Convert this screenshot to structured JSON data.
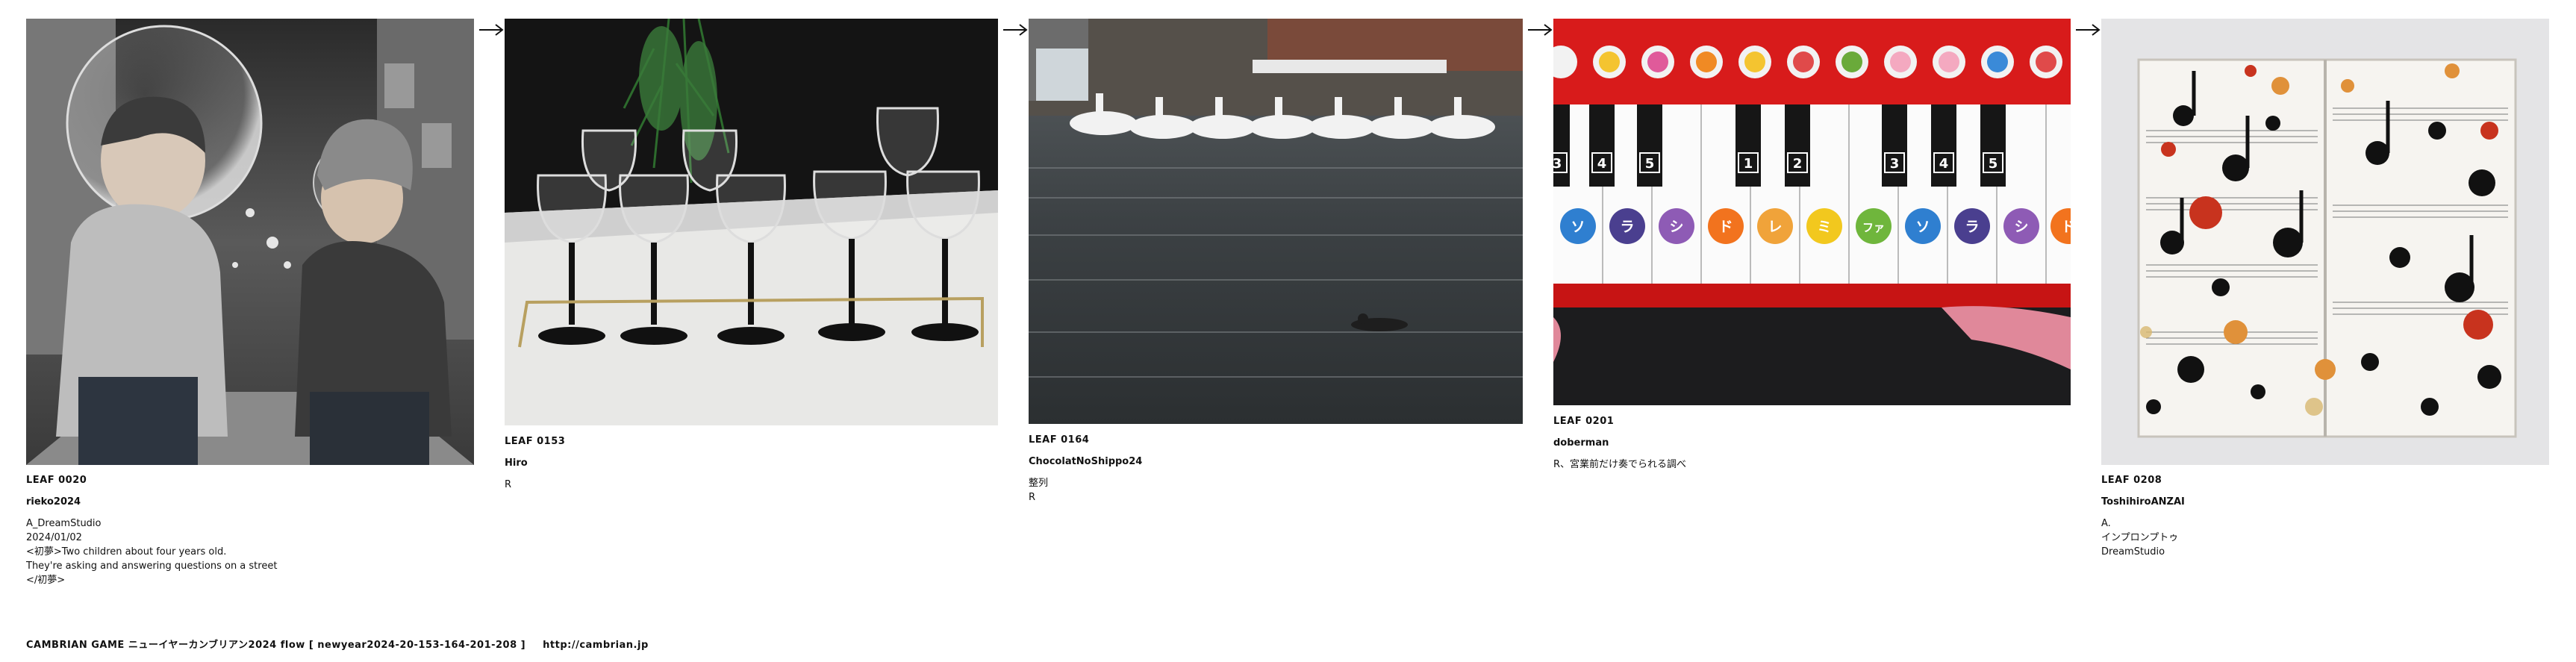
{
  "leaves": [
    {
      "id": "LEAF 0020",
      "author": "rieko2024",
      "desc_lines": [
        "A_DreamStudio",
        "2024/01/02",
        "<初夢>Two children about four years old.",
        "They're asking and answering questions on a street",
        "</初夢>"
      ],
      "image": "Two children in knit caps facing each other on a city street, one touching a large bubble"
    },
    {
      "id": "LEAF 0153",
      "author": "Hiro",
      "desc_lines": [
        "R"
      ],
      "image": "Row of wine glasses on black stems on a white tray with pine branches"
    },
    {
      "id": "LEAF 0164",
      "author": "ChocolatNoShippo24",
      "desc_lines": [
        "整列",
        "R"
      ],
      "image": "Swan paddle boats lined up on a pond with a small bird swimming"
    },
    {
      "id": "LEAF 0201",
      "author": "doberman",
      "desc_lines": [
        "R、宮業前だけ奏でられる調べ"
      ],
      "image": "Red toy keyboard with numbered black keys and katakana note stickers"
    },
    {
      "id": "LEAF 0208",
      "author": "ToshihiroANZAI",
      "desc_lines": [
        "A.",
        "インプロンプトゥ",
        "DreamStudio"
      ],
      "image": "Open sheet music book splattered with black, red and orange paint"
    }
  ],
  "piano_labels": {
    "numbers": [
      "3",
      "4",
      "5",
      "1",
      "2",
      "3",
      "4",
      "5"
    ],
    "solfege": [
      "ソ",
      "ラ",
      "シ",
      "ド",
      "レ",
      "ミ",
      "ファ",
      "ソ",
      "ラ",
      "シ",
      "ド"
    ]
  },
  "arrow_glyph": "→",
  "footer": {
    "text": "CAMBRIAN GAME  ニューイヤーカンブリアン2024  flow [ newyear2024-20-153-164-201-208 ]",
    "link": "http://cambrian.jp"
  },
  "colors": {
    "text": "#111111",
    "background": "#ffffff",
    "keyboard_red": "#d81b1b"
  }
}
